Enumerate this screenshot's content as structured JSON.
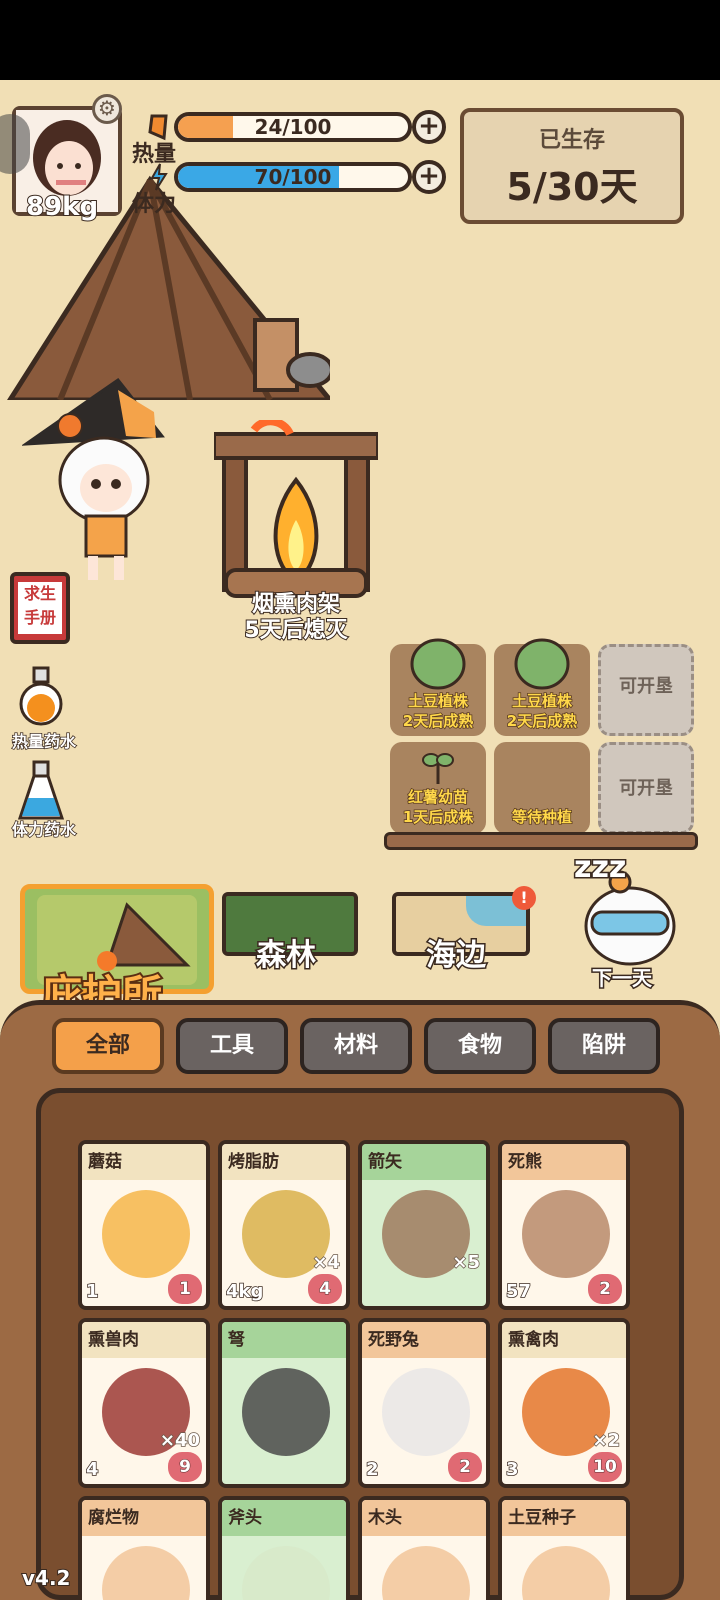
{
  "hud": {
    "weight": "89kg",
    "calories_label": "热量",
    "calories_value": "24/100",
    "calories_fraction": 0.24,
    "stamina_label": "体力",
    "stamina_value": "70/100",
    "stamina_fraction": 0.7,
    "survive_label": "已生存",
    "survive_days": "5/30天"
  },
  "side": {
    "manual_line1": "求生",
    "manual_line2": "手册",
    "potion_calories": "热量药水",
    "potion_stamina": "体力药水"
  },
  "camp": {
    "smoker_name": "烟熏肉架",
    "smoker_status": "5天后熄灭"
  },
  "plots": [
    {
      "line1": "土豆植株",
      "line2": "2天后成熟"
    },
    {
      "line1": "土豆植株",
      "line2": "2天后成熟"
    },
    {
      "line1": "可开垦",
      "line2": ""
    },
    {
      "line1": "红薯幼苗",
      "line2": "1天后成株"
    },
    {
      "line1": "等待种植",
      "line2": ""
    },
    {
      "line1": "可开垦",
      "line2": ""
    }
  ],
  "locations": {
    "shelter": "庇护所",
    "forest": "森林",
    "beach": "海边",
    "next_day": "下一天",
    "sleep_icon": "zzz"
  },
  "categories": [
    "全部",
    "工具",
    "材料",
    "食物",
    "陷阱"
  ],
  "items": [
    {
      "name": "蘑菇",
      "qty": "",
      "left": "1",
      "right": "1",
      "color": "#f6b64a"
    },
    {
      "name": "烤脂肪",
      "qty": "×4",
      "left": "4kg",
      "right": "4",
      "color": "#d9b04a"
    },
    {
      "name": "箭矢",
      "qty": "×5",
      "left": "",
      "right": "",
      "color": "#9d7a5e"
    },
    {
      "name": "死熊",
      "qty": "",
      "left": "57",
      "right": "2",
      "color": "#b98a6a"
    },
    {
      "name": "熏兽肉",
      "qty": "×40",
      "left": "4",
      "right": "9",
      "color": "#9c3a35"
    },
    {
      "name": "弩",
      "qty": "",
      "left": "",
      "right": "",
      "color": "#4a4a4a"
    },
    {
      "name": "死野兔",
      "qty": "",
      "left": "2",
      "right": "2",
      "color": "#e9e6e6"
    },
    {
      "name": "熏禽肉",
      "qty": "×2",
      "left": "3",
      "right": "10",
      "color": "#e4752c"
    },
    {
      "name": "腐烂物",
      "qty": "",
      "left": "",
      "right": "",
      "color": "#f2c69a"
    },
    {
      "name": "斧头",
      "qty": "",
      "left": "",
      "right": "",
      "color": "#d7e9c9"
    },
    {
      "name": "木头",
      "qty": "",
      "left": "",
      "right": "",
      "color": "#f2c69a"
    },
    {
      "name": "土豆种子",
      "qty": "",
      "left": "",
      "right": "",
      "color": "#f2c69a"
    }
  ],
  "version": "v4.2"
}
